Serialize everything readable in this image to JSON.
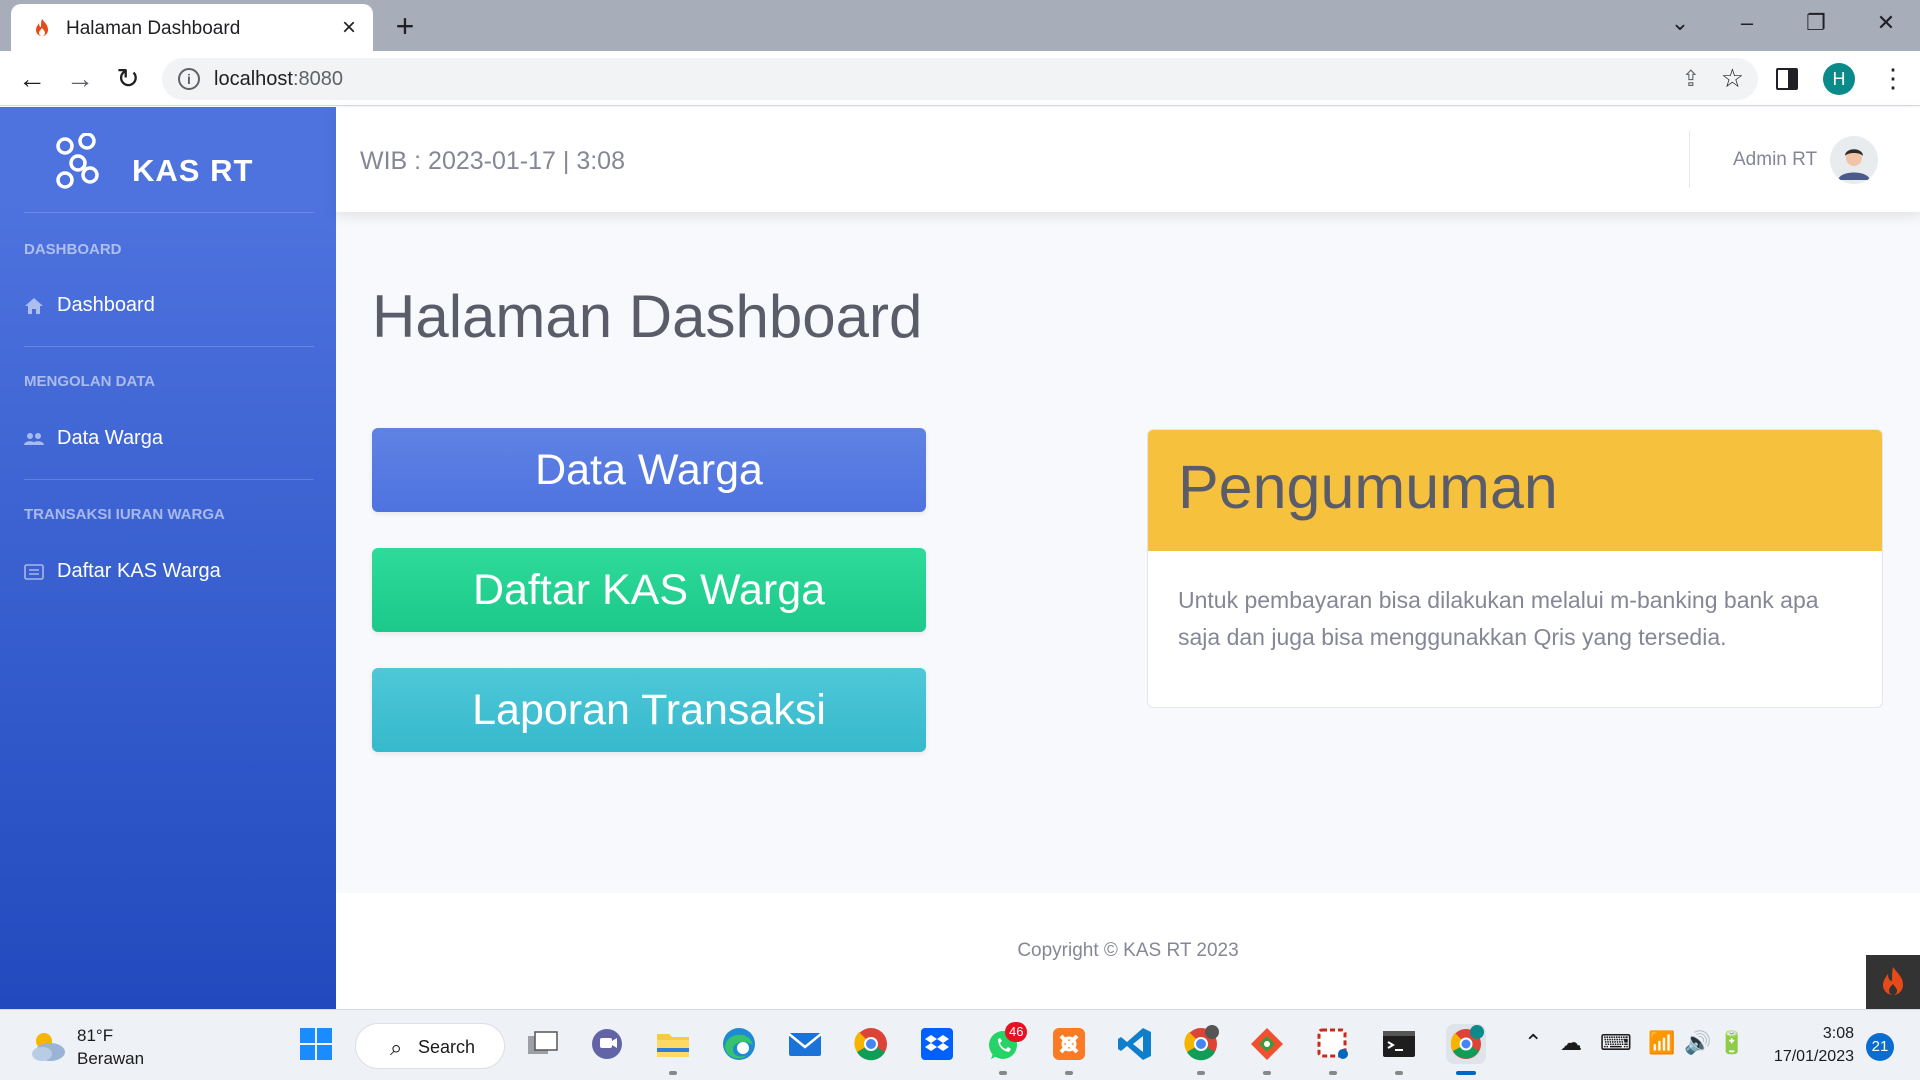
{
  "browser": {
    "tab_title": "Halaman Dashboard",
    "url_host": "localhost",
    "url_port": ":8080",
    "profile_initial": "H"
  },
  "app": {
    "brand": "KAS RT",
    "sidebar": {
      "sections": [
        {
          "heading": "DASHBOARD",
          "items": [
            {
              "label": "Dashboard",
              "icon": "home-icon"
            }
          ]
        },
        {
          "heading": "MENGOLAN DATA",
          "items": [
            {
              "label": "Data Warga",
              "icon": "users-icon"
            }
          ]
        },
        {
          "heading": "TRANSAKSI IURAN WARGA",
          "items": [
            {
              "label": "Daftar KAS Warga",
              "icon": "list-icon"
            }
          ]
        }
      ]
    },
    "topbar": {
      "clock": "WIB : 2023-01-17 | 3:08",
      "user_name": "Admin RT"
    },
    "page_title": "Halaman Dashboard",
    "buttons": {
      "data_warga": "Data Warga",
      "daftar_kas": "Daftar KAS Warga",
      "laporan": "Laporan Transaksi"
    },
    "announcement": {
      "title": "Pengumuman",
      "body": "Untuk pembayaran bisa dilakukan melalui m-banking bank apa saja dan juga bisa menggunakkan Qris yang tersedia."
    },
    "footer": "Copyright © KAS RT 2023",
    "colors": {
      "sidebar_top": "#4e73df",
      "sidebar_bottom": "#224abe",
      "primary": "#4e73df",
      "success": "#1cc88a",
      "info": "#36b9cc",
      "warning": "#f6c23e"
    }
  },
  "taskbar": {
    "weather_temp": "81°F",
    "weather_desc": "Berawan",
    "search_label": "Search",
    "whatsapp_badge": "46",
    "time": "3:08",
    "date": "17/01/2023",
    "notification_count": "21"
  }
}
